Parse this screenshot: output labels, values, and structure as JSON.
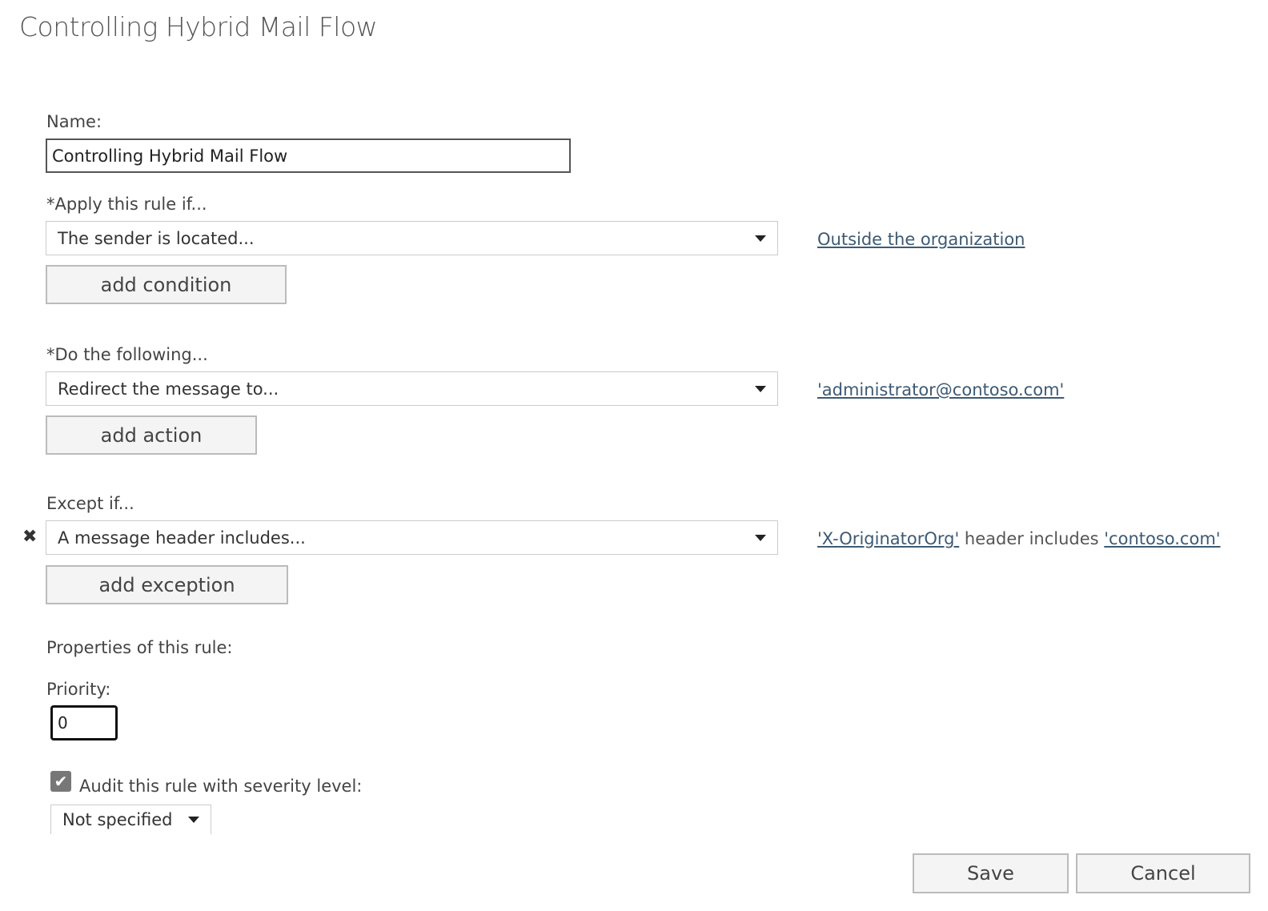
{
  "title": "Controlling Hybrid Mail Flow",
  "name": {
    "label": "Name:",
    "value": "Controlling Hybrid Mail Flow"
  },
  "condition": {
    "label": "*Apply this rule if...",
    "selected": "The sender is located...",
    "link": "Outside the organization",
    "add_label": "add condition"
  },
  "action": {
    "label": "*Do the following...",
    "selected": "Redirect the message to...",
    "link": "'administrator@contoso.com'",
    "add_label": "add action"
  },
  "exception": {
    "label": "Except if...",
    "selected": "A message header includes...",
    "link1": "'X-OriginatorOrg'",
    "middle": " header includes ",
    "link2": "'contoso.com'",
    "add_label": "add exception",
    "remove_icon": "✖"
  },
  "properties": {
    "label": "Properties of this rule:",
    "priority_label": "Priority:",
    "priority_value": "0",
    "audit_label": "Audit this rule with severity level:",
    "audit_checked": true,
    "severity": "Not specified"
  },
  "footer": {
    "save": "Save",
    "cancel": "Cancel"
  }
}
